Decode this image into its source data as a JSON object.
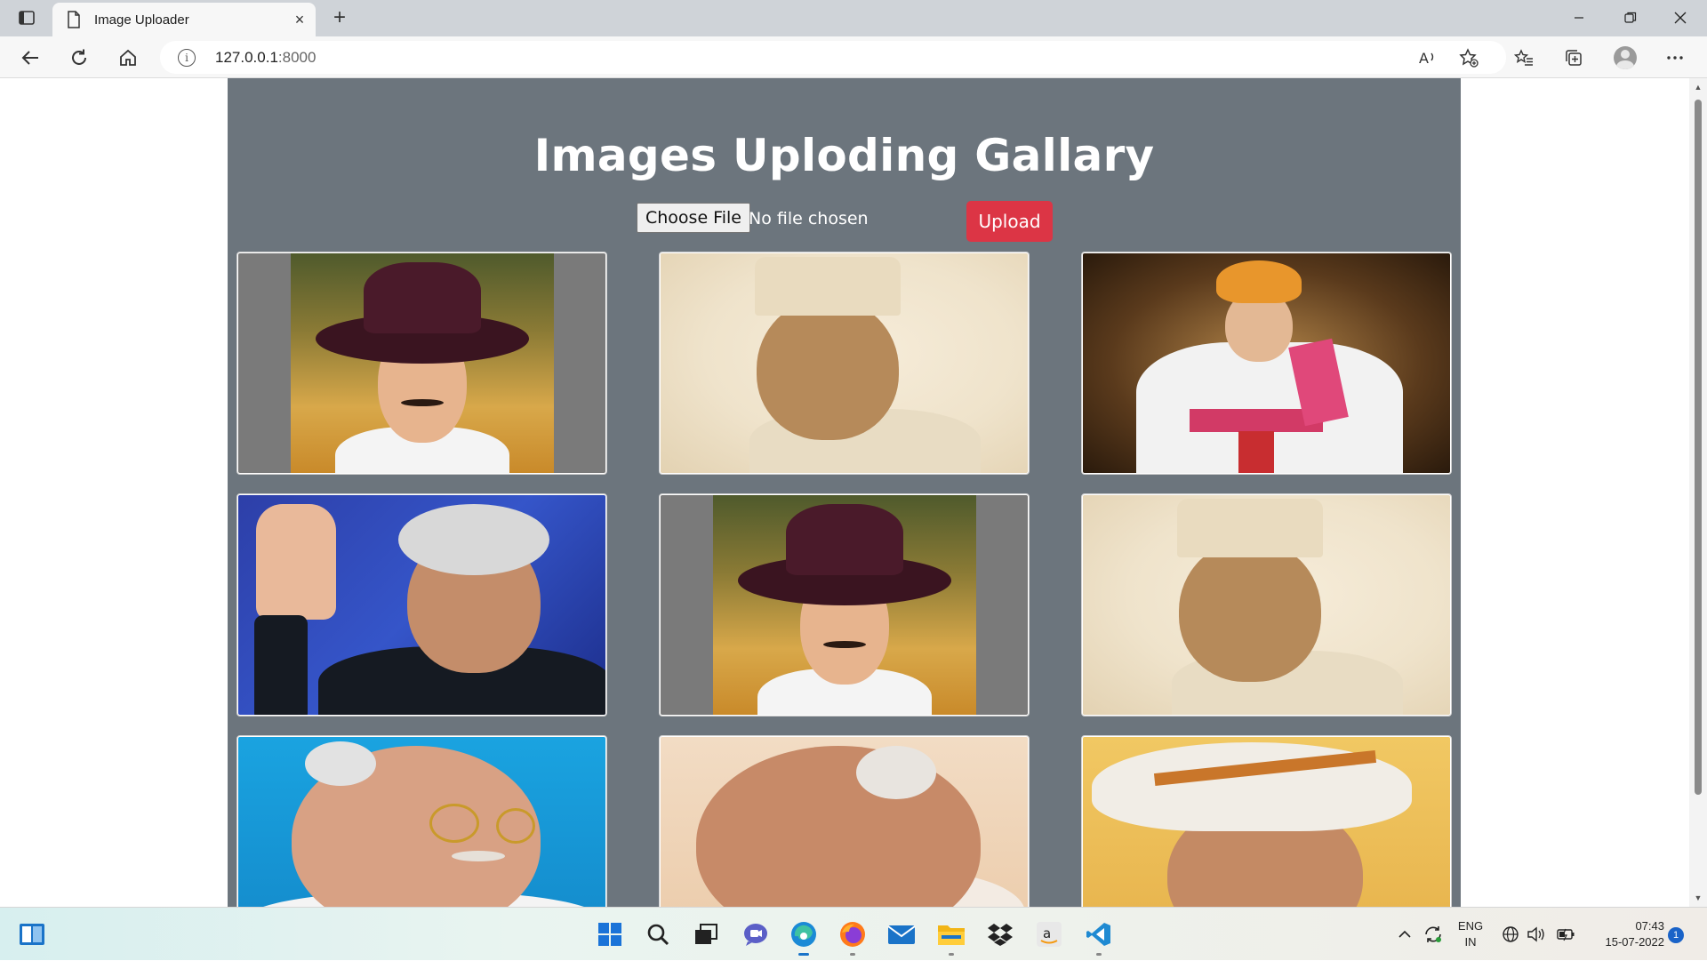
{
  "browser": {
    "tab_title": "Image Uploader",
    "tab_close": "×",
    "new_tab": "+",
    "url_host": "127.0.0.1",
    "url_port": ":8000",
    "window_controls": [
      "minimize",
      "restore",
      "close"
    ]
  },
  "page": {
    "heading": "Images Uploding Gallary",
    "choose_file_label": "Choose File",
    "file_status": "No file chosen",
    "upload_label": "Upload",
    "gallery": [
      {
        "id": "bhagat-singh",
        "style": "hat"
      },
      {
        "id": "shastri",
        "style": "cap"
      },
      {
        "id": "maharaja",
        "style": "turban"
      },
      {
        "id": "kalam",
        "style": "wave"
      },
      {
        "id": "bhagat-singh-2",
        "style": "hat"
      },
      {
        "id": "shastri-2",
        "style": "cap"
      },
      {
        "id": "gandhi",
        "style": "glasses"
      },
      {
        "id": "patel",
        "style": "patel"
      },
      {
        "id": "visvesvaraya",
        "style": "engineer"
      }
    ]
  },
  "taskbar": {
    "language": "ENG",
    "region": "IN",
    "time": "07:43",
    "date": "15-07-2022",
    "notification_count": "1"
  },
  "colors": {
    "container_bg": "#6c757d",
    "upload_button": "#dc3545",
    "page_bg": "#ffffff"
  }
}
